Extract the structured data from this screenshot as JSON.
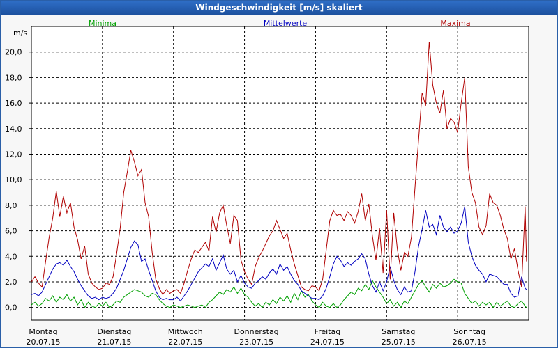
{
  "window": {
    "title": "Windgeschwindigkeit [m/s] skaliert"
  },
  "chart_data": {
    "type": "line",
    "title": "Windgeschwindigkeit [m/s] skaliert",
    "ylabel": "m/s",
    "ylim": [
      -1.0,
      22.0
    ],
    "xlim": [
      0,
      7
    ],
    "y_ticks": [
      "0,0",
      "2,0",
      "4,0",
      "6,0",
      "8,0",
      "10,0",
      "12,0",
      "14,0",
      "16,0",
      "18,0",
      "20,0"
    ],
    "x_ticks": [
      {
        "day": "Montag",
        "date": "20.07.15"
      },
      {
        "day": "Dienstag",
        "date": "21.07.15"
      },
      {
        "day": "Mittwoch",
        "date": "22.07.15"
      },
      {
        "day": "Donnerstag",
        "date": "23.07.15"
      },
      {
        "day": "Freitag",
        "date": "24.07.15"
      },
      {
        "day": "Samstag",
        "date": "25.07.15"
      },
      {
        "day": "Sonntag",
        "date": "26.07.15"
      }
    ],
    "grid": true,
    "legend_position": "top",
    "series": [
      {
        "name": "Minima",
        "color": "#00a000",
        "x": [
          0.0,
          0.05,
          0.1,
          0.15,
          0.2,
          0.25,
          0.3,
          0.35,
          0.4,
          0.45,
          0.5,
          0.55,
          0.6,
          0.65,
          0.7,
          0.75,
          0.8,
          0.85,
          0.9,
          0.95,
          1.0,
          1.05,
          1.1,
          1.15,
          1.2,
          1.25,
          1.3,
          1.35,
          1.4,
          1.45,
          1.5,
          1.55,
          1.6,
          1.65,
          1.7,
          1.75,
          1.8,
          1.85,
          1.9,
          1.95,
          2.0,
          2.05,
          2.1,
          2.15,
          2.2,
          2.25,
          2.3,
          2.35,
          2.4,
          2.45,
          2.5,
          2.55,
          2.6,
          2.65,
          2.7,
          2.75,
          2.8,
          2.85,
          2.9,
          2.95,
          3.0,
          3.05,
          3.1,
          3.15,
          3.2,
          3.25,
          3.3,
          3.35,
          3.4,
          3.45,
          3.5,
          3.55,
          3.6,
          3.65,
          3.7,
          3.75,
          3.8,
          3.85,
          3.9,
          3.95,
          4.0,
          4.05,
          4.1,
          4.15,
          4.2,
          4.25,
          4.3,
          4.35,
          4.4,
          4.45,
          4.5,
          4.55,
          4.6,
          4.65,
          4.7,
          4.75,
          4.8,
          4.85,
          4.9,
          4.95,
          5.0,
          5.05,
          5.1,
          5.15,
          5.2,
          5.25,
          5.3,
          5.35,
          5.4,
          5.45,
          5.5,
          5.55,
          5.6,
          5.65,
          5.7,
          5.75,
          5.8,
          5.85,
          5.9,
          5.95,
          6.0,
          6.05,
          6.1,
          6.15,
          6.2,
          6.25,
          6.3,
          6.35,
          6.4,
          6.45,
          6.5,
          6.55,
          6.6,
          6.65,
          6.7,
          6.75,
          6.8,
          6.85,
          6.9,
          6.95,
          6.97
        ],
        "values": [
          0.2,
          0.4,
          0.1,
          0.3,
          0.7,
          0.5,
          0.9,
          0.4,
          0.8,
          0.6,
          1.0,
          0.5,
          0.8,
          0.2,
          0.6,
          0.0,
          0.4,
          0.1,
          0.0,
          0.3,
          0.1,
          0.4,
          0.0,
          0.2,
          0.5,
          0.4,
          0.8,
          1.0,
          1.2,
          1.4,
          1.3,
          1.2,
          0.9,
          0.8,
          1.1,
          1.0,
          0.6,
          0.3,
          0.1,
          0.0,
          0.2,
          0.1,
          0.0,
          0.1,
          0.2,
          0.1,
          0.0,
          0.1,
          0.2,
          0.0,
          0.4,
          0.6,
          0.9,
          1.2,
          1.0,
          1.4,
          1.2,
          1.6,
          1.1,
          1.5,
          1.0,
          0.8,
          0.4,
          0.1,
          0.3,
          0.0,
          0.4,
          0.2,
          0.6,
          0.3,
          0.8,
          0.5,
          0.9,
          0.4,
          1.1,
          0.6,
          1.3,
          0.8,
          1.0,
          0.5,
          0.2,
          0.0,
          0.4,
          0.1,
          0.0,
          0.3,
          0.0,
          0.2,
          0.6,
          0.9,
          1.2,
          1.0,
          1.5,
          1.3,
          1.8,
          1.4,
          2.1,
          1.6,
          1.2,
          0.8,
          0.3,
          0.6,
          0.1,
          0.4,
          0.0,
          0.5,
          0.3,
          0.8,
          1.3,
          1.8,
          2.1,
          1.6,
          1.2,
          1.8,
          1.5,
          1.9,
          1.6,
          1.7,
          1.9,
          2.2,
          2.0,
          1.9,
          1.1,
          0.7,
          0.3,
          0.5,
          0.1,
          0.4,
          0.2,
          0.4,
          0.0,
          0.4,
          0.1,
          0.3,
          0.5,
          0.1,
          0.0,
          0.3,
          0.5,
          0.1,
          0.0
        ]
      },
      {
        "name": "Mittelwerte",
        "color": "#0000c0",
        "x": [
          0.0,
          0.05,
          0.1,
          0.15,
          0.2,
          0.25,
          0.3,
          0.35,
          0.4,
          0.45,
          0.5,
          0.55,
          0.6,
          0.65,
          0.7,
          0.75,
          0.8,
          0.85,
          0.9,
          0.95,
          1.0,
          1.05,
          1.1,
          1.15,
          1.2,
          1.25,
          1.3,
          1.35,
          1.4,
          1.45,
          1.5,
          1.55,
          1.6,
          1.65,
          1.7,
          1.75,
          1.8,
          1.85,
          1.9,
          1.95,
          2.0,
          2.05,
          2.1,
          2.15,
          2.2,
          2.25,
          2.3,
          2.35,
          2.4,
          2.45,
          2.5,
          2.55,
          2.6,
          2.65,
          2.7,
          2.75,
          2.8,
          2.85,
          2.9,
          2.95,
          3.0,
          3.05,
          3.1,
          3.15,
          3.2,
          3.25,
          3.3,
          3.35,
          3.4,
          3.45,
          3.5,
          3.55,
          3.6,
          3.65,
          3.7,
          3.75,
          3.8,
          3.85,
          3.9,
          3.95,
          4.0,
          4.05,
          4.1,
          4.15,
          4.2,
          4.25,
          4.3,
          4.35,
          4.4,
          4.45,
          4.5,
          4.55,
          4.6,
          4.65,
          4.7,
          4.75,
          4.8,
          4.85,
          4.9,
          4.95,
          5.0,
          5.05,
          5.1,
          5.15,
          5.2,
          5.25,
          5.3,
          5.35,
          5.4,
          5.45,
          5.5,
          5.55,
          5.6,
          5.65,
          5.7,
          5.75,
          5.8,
          5.85,
          5.9,
          5.95,
          6.0,
          6.05,
          6.1,
          6.15,
          6.2,
          6.25,
          6.3,
          6.35,
          6.4,
          6.45,
          6.5,
          6.55,
          6.6,
          6.65,
          6.7,
          6.75,
          6.8,
          6.85,
          6.9,
          6.95,
          6.97
        ],
        "values": [
          1.0,
          1.1,
          0.9,
          1.2,
          1.8,
          2.4,
          3.0,
          3.4,
          3.5,
          3.3,
          3.7,
          3.2,
          2.8,
          2.2,
          1.7,
          1.3,
          0.9,
          0.7,
          0.8,
          0.6,
          0.8,
          0.7,
          0.8,
          1.1,
          1.5,
          2.2,
          2.9,
          3.8,
          4.7,
          5.2,
          4.9,
          3.6,
          3.8,
          2.9,
          2.1,
          1.3,
          0.8,
          0.6,
          0.7,
          0.6,
          0.6,
          0.8,
          0.5,
          0.9,
          1.3,
          1.8,
          2.3,
          2.8,
          3.1,
          3.4,
          3.2,
          3.8,
          2.9,
          3.5,
          4.1,
          3.0,
          2.6,
          2.9,
          2.0,
          2.5,
          1.9,
          1.6,
          1.5,
          1.9,
          2.1,
          2.4,
          2.2,
          2.7,
          3.0,
          2.6,
          3.4,
          2.9,
          3.2,
          2.6,
          2.1,
          1.8,
          1.3,
          1.1,
          0.9,
          0.7,
          0.7,
          0.6,
          0.9,
          1.5,
          2.4,
          3.4,
          4.0,
          3.7,
          3.2,
          3.5,
          3.3,
          3.6,
          3.8,
          4.2,
          3.8,
          2.6,
          1.7,
          1.2,
          2.0,
          1.3,
          2.0,
          3.2,
          2.1,
          1.4,
          1.0,
          1.6,
          1.2,
          1.3,
          2.8,
          4.8,
          6.1,
          7.6,
          6.3,
          6.5,
          5.7,
          7.2,
          6.3,
          5.9,
          6.3,
          5.8,
          6.0,
          6.6,
          7.9,
          5.1,
          4.0,
          3.3,
          2.9,
          2.6,
          2.0,
          2.6,
          2.5,
          2.4,
          2.1,
          1.8,
          1.8,
          1.1,
          0.8,
          0.9,
          2.4,
          1.5,
          1.4
        ]
      },
      {
        "name": "Maxima",
        "color": "#b00000",
        "x": [
          0.0,
          0.05,
          0.1,
          0.15,
          0.2,
          0.25,
          0.3,
          0.35,
          0.4,
          0.45,
          0.5,
          0.55,
          0.6,
          0.65,
          0.7,
          0.75,
          0.8,
          0.85,
          0.9,
          0.95,
          1.0,
          1.05,
          1.1,
          1.15,
          1.2,
          1.25,
          1.3,
          1.35,
          1.4,
          1.45,
          1.5,
          1.55,
          1.6,
          1.65,
          1.7,
          1.75,
          1.8,
          1.85,
          1.9,
          1.95,
          2.0,
          2.05,
          2.1,
          2.15,
          2.2,
          2.25,
          2.3,
          2.35,
          2.4,
          2.45,
          2.5,
          2.55,
          2.6,
          2.65,
          2.7,
          2.75,
          2.8,
          2.85,
          2.9,
          2.95,
          3.0,
          3.05,
          3.1,
          3.15,
          3.2,
          3.25,
          3.3,
          3.35,
          3.4,
          3.45,
          3.5,
          3.55,
          3.6,
          3.65,
          3.7,
          3.75,
          3.8,
          3.85,
          3.9,
          3.95,
          4.0,
          4.05,
          4.1,
          4.15,
          4.2,
          4.25,
          4.3,
          4.35,
          4.4,
          4.45,
          4.5,
          4.55,
          4.6,
          4.65,
          4.7,
          4.75,
          4.8,
          4.85,
          4.9,
          4.95,
          5.0,
          5.05,
          5.1,
          5.15,
          5.2,
          5.25,
          5.3,
          5.35,
          5.4,
          5.45,
          5.5,
          5.55,
          5.6,
          5.65,
          5.7,
          5.75,
          5.8,
          5.85,
          5.9,
          5.95,
          6.0,
          6.05,
          6.1,
          6.15,
          6.2,
          6.25,
          6.3,
          6.35,
          6.4,
          6.45,
          6.5,
          6.55,
          6.6,
          6.65,
          6.7,
          6.75,
          6.8,
          6.85,
          6.9,
          6.95,
          6.97
        ],
        "values": [
          2.0,
          2.4,
          1.9,
          1.6,
          3.6,
          5.5,
          7.0,
          9.1,
          7.1,
          8.7,
          7.4,
          8.2,
          6.3,
          5.3,
          3.8,
          4.8,
          2.6,
          1.9,
          1.6,
          1.4,
          1.5,
          1.9,
          1.8,
          2.4,
          4.2,
          6.2,
          9.0,
          10.6,
          12.3,
          11.4,
          10.3,
          10.8,
          8.2,
          7.1,
          4.3,
          2.2,
          1.5,
          1.0,
          1.4,
          1.1,
          1.3,
          1.4,
          1.1,
          1.9,
          2.9,
          3.8,
          4.5,
          4.3,
          4.7,
          5.1,
          4.4,
          7.1,
          5.9,
          7.4,
          8.0,
          6.4,
          5.0,
          7.2,
          6.8,
          3.7,
          2.8,
          2.2,
          1.8,
          3.2,
          3.9,
          4.4,
          5.0,
          5.6,
          6.0,
          6.8,
          6.1,
          5.4,
          5.8,
          4.5,
          3.4,
          2.5,
          1.6,
          1.4,
          1.3,
          1.7,
          1.6,
          1.3,
          2.2,
          4.5,
          6.8,
          7.6,
          7.2,
          7.3,
          6.8,
          7.5,
          7.2,
          6.6,
          7.5,
          8.9,
          6.8,
          8.1,
          5.6,
          3.7,
          6.2,
          2.7,
          7.6,
          2.2,
          7.4,
          4.6,
          2.9,
          4.3,
          4.0,
          5.5,
          9.4,
          13.1,
          16.8,
          15.8,
          20.8,
          17.4,
          16.0,
          15.2,
          17.0,
          14.0,
          14.8,
          14.5,
          13.7,
          16.0,
          18.0,
          11.0,
          9.0,
          8.2,
          6.3,
          5.7,
          6.4,
          8.9,
          8.2,
          8.0,
          7.2,
          6.1,
          5.4,
          3.8,
          4.6,
          2.9,
          1.6,
          7.9,
          3.6
        ]
      }
    ]
  }
}
